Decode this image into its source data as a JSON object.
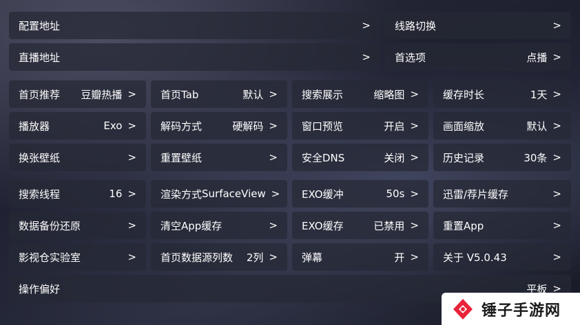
{
  "chevron": ">",
  "rows": [
    [
      {
        "label": "配置地址",
        "value": ""
      },
      {
        "label": "线路切换",
        "value": ""
      }
    ],
    [
      {
        "label": "直播地址",
        "value": ""
      },
      {
        "label": "首选项",
        "value": "点播"
      }
    ],
    [
      {
        "label": "首页推荐",
        "value": "豆瓣热播"
      },
      {
        "label": "首页Tab",
        "value": "默认"
      },
      {
        "label": "搜索展示",
        "value": "缩略图"
      },
      {
        "label": "缓存时长",
        "value": "1天"
      }
    ],
    [
      {
        "label": "播放器",
        "value": "Exo"
      },
      {
        "label": "解码方式",
        "value": "硬解码"
      },
      {
        "label": "窗口预览",
        "value": "开启"
      },
      {
        "label": "画面缩放",
        "value": "默认"
      }
    ],
    [
      {
        "label": "换张壁纸",
        "value": ""
      },
      {
        "label": "重置壁纸",
        "value": ""
      },
      {
        "label": "安全DNS",
        "value": "关闭"
      },
      {
        "label": "历史记录",
        "value": "30条"
      }
    ],
    [
      {
        "label": "搜索线程",
        "value": "16"
      },
      {
        "label": "渲染方式",
        "value": "SurfaceView"
      },
      {
        "label": "EXO缓冲",
        "value": "50s"
      },
      {
        "label": "迅雷/荐片缓存",
        "value": ""
      }
    ],
    [
      {
        "label": "数据备份还原",
        "value": ""
      },
      {
        "label": "清空App缓存",
        "value": ""
      },
      {
        "label": "EXO缓存",
        "value": "已禁用"
      },
      {
        "label": "重置App",
        "value": ""
      }
    ],
    [
      {
        "label": "影视仓实验室",
        "value": ""
      },
      {
        "label": "首页数据源列数",
        "value": "2列"
      },
      {
        "label": "弹幕",
        "value": "开"
      },
      {
        "label": "关于  V5.0.43",
        "value": ""
      }
    ],
    [
      {
        "label": "操作偏好",
        "value": "平板"
      }
    ]
  ],
  "watermark": {
    "text": "锤子手游网",
    "logo_color": "#e8233a"
  }
}
